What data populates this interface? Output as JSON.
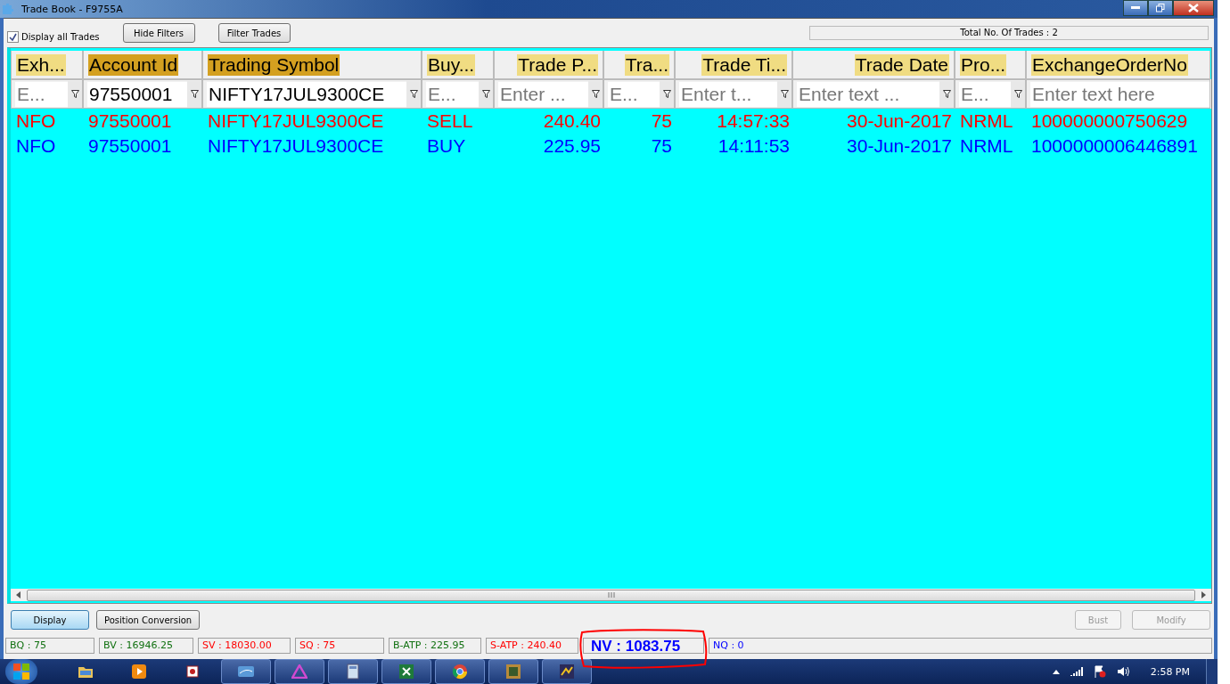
{
  "window": {
    "title": "Trade Book - F9755A"
  },
  "toolbar": {
    "display_all": {
      "label": "Display all Trades",
      "checked": true
    },
    "buttons": [
      "Hide Filters",
      "Filter Trades"
    ],
    "total": "Total No. Of Trades : 2"
  },
  "table": {
    "columns": [
      {
        "label": "Exh...",
        "filtered": false,
        "numeric": false,
        "filter_placeholder": "E..."
      },
      {
        "label": "Account Id",
        "filtered": true,
        "numeric": false,
        "filter_value": "97550001"
      },
      {
        "label": "Trading Symbol",
        "filtered": true,
        "numeric": false,
        "filter_value": "NIFTY17JUL9300CE"
      },
      {
        "label": "Buy...",
        "filtered": false,
        "numeric": false,
        "filter_placeholder": "E..."
      },
      {
        "label": "Trade P...",
        "filtered": false,
        "numeric": true,
        "filter_placeholder": "Enter ..."
      },
      {
        "label": "Tra...",
        "filtered": false,
        "numeric": true,
        "filter_placeholder": "E..."
      },
      {
        "label": "Trade Ti...",
        "filtered": false,
        "numeric": true,
        "filter_placeholder": "Enter t..."
      },
      {
        "label": "Trade Date",
        "filtered": false,
        "numeric": true,
        "filter_placeholder": "Enter text ..."
      },
      {
        "label": "Pro...",
        "filtered": false,
        "numeric": false,
        "filter_placeholder": "E..."
      },
      {
        "label": "ExchangeOrderNo",
        "filtered": false,
        "numeric": false,
        "filter_placeholder": "Enter text here"
      }
    ],
    "rows": [
      {
        "color": "#ff0000",
        "cells": [
          "NFO",
          "97550001",
          "NIFTY17JUL9300CE",
          "SELL",
          "240.40",
          "75",
          "14:57:33",
          "30-Jun-2017",
          "NRML",
          "100000000750629"
        ]
      },
      {
        "color": "#0000ff",
        "cells": [
          "NFO",
          "97550001",
          "NIFTY17JUL9300CE",
          "BUY",
          "225.95",
          "75",
          "14:11:53",
          "30-Jun-2017",
          "NRML",
          "1000000006446891"
        ]
      }
    ]
  },
  "actions": {
    "left": [
      {
        "label": "Display",
        "disabled": false,
        "selected": true
      },
      {
        "label": "Position Conversion",
        "disabled": false,
        "selected": false
      }
    ],
    "right": [
      {
        "label": "Bust",
        "disabled": true
      },
      {
        "label": "Modify",
        "disabled": true
      }
    ]
  },
  "status_bar": [
    {
      "text": "BQ : 75",
      "color": "#107010",
      "circled": false
    },
    {
      "text": "BV : 16946.25",
      "color": "#107010",
      "circled": false
    },
    {
      "text": "SV : 18030.00",
      "color": "#ff0000",
      "circled": false
    },
    {
      "text": "SQ : 75",
      "color": "#ff0000",
      "circled": false
    },
    {
      "text": "B-ATP : 225.95",
      "color": "#107010",
      "circled": false
    },
    {
      "text": "S-ATP : 240.40",
      "color": "#ff0000",
      "circled": false
    },
    {
      "text": "NV : 1083.75",
      "color": "#0000ff",
      "circled": true
    },
    {
      "text": "NQ : 0",
      "color": "#0000ff",
      "circled": false
    }
  ],
  "taskbar": {
    "items": [
      {
        "kind": "folder",
        "running": false
      },
      {
        "kind": "media",
        "running": false
      },
      {
        "kind": "app",
        "running": false
      },
      {
        "kind": "window",
        "running": true
      },
      {
        "kind": "triangle",
        "running": true
      },
      {
        "kind": "calculator",
        "running": true
      },
      {
        "kind": "spreadsheet",
        "running": true
      },
      {
        "kind": "browser",
        "running": true
      },
      {
        "kind": "picture",
        "running": true
      },
      {
        "kind": "chart",
        "running": true
      }
    ],
    "clock": "2:58 PM"
  }
}
